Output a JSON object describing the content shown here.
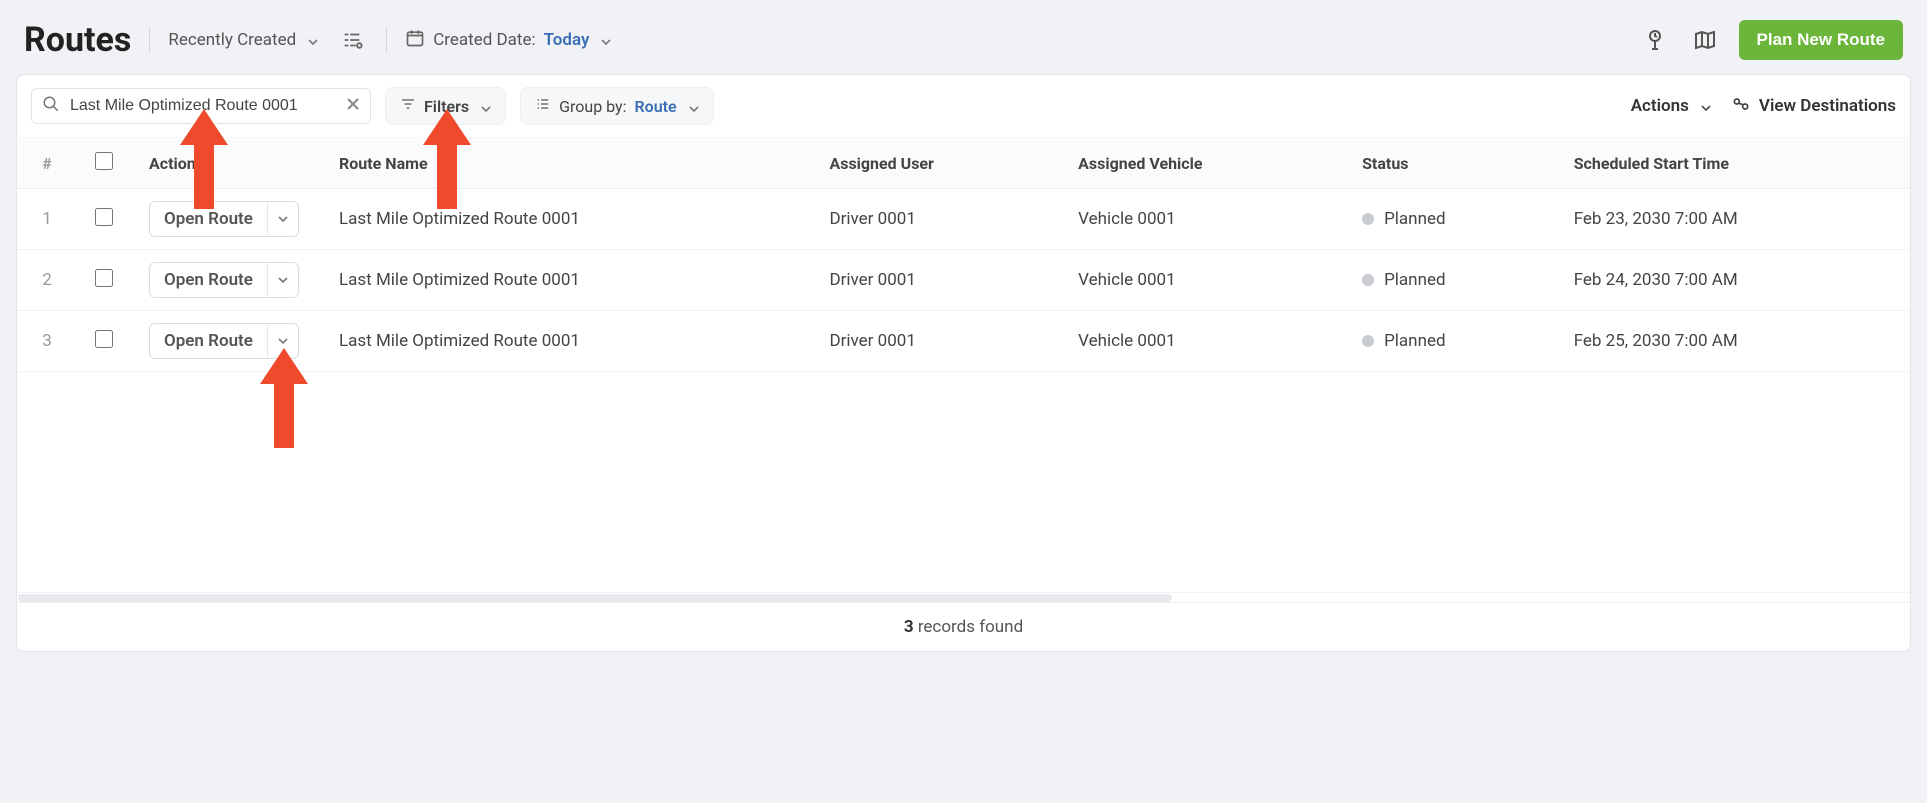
{
  "header": {
    "title": "Routes",
    "recently_created": "Recently Created",
    "created_date_label": "Created Date:",
    "created_date_value": "Today",
    "plan_button": "Plan New Route"
  },
  "toolbar": {
    "search_value": "Last Mile Optimized Route 0001",
    "filters_label": "Filters",
    "group_by_label": "Group by:",
    "group_by_value": "Route",
    "actions_label": "Actions",
    "view_destinations": "View Destinations"
  },
  "columns": {
    "num": "#",
    "actions": "Actions",
    "route_name": "Route Name",
    "assigned_user": "Assigned User",
    "assigned_vehicle": "Assigned Vehicle",
    "status": "Status",
    "scheduled_start": "Scheduled Start Time"
  },
  "row_action_label": "Open Route",
  "rows": [
    {
      "num": "1",
      "name": "Last Mile Optimized Route 0001",
      "user": "Driver 0001",
      "vehicle": "Vehicle 0001",
      "status": "Planned",
      "start": "Feb 23, 2030 7:00 AM"
    },
    {
      "num": "2",
      "name": "Last Mile Optimized Route 0001",
      "user": "Driver 0001",
      "vehicle": "Vehicle 0001",
      "status": "Planned",
      "start": "Feb 24, 2030 7:00 AM"
    },
    {
      "num": "3",
      "name": "Last Mile Optimized Route 0001",
      "user": "Driver 0001",
      "vehicle": "Vehicle 0001",
      "status": "Planned",
      "start": "Feb 25, 2030 7:00 AM"
    }
  ],
  "footer": {
    "count": "3",
    "label": "records found"
  }
}
